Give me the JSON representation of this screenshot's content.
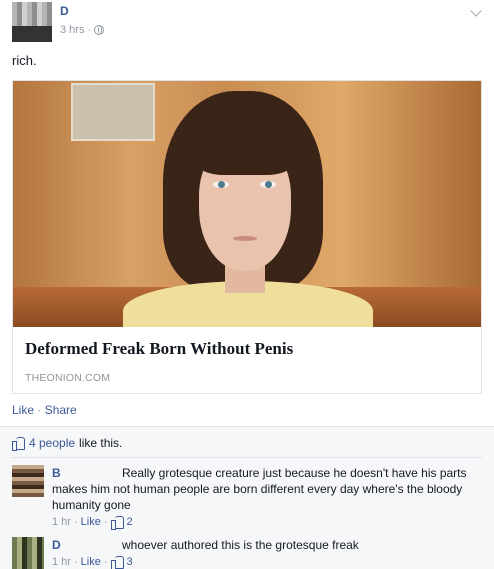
{
  "post": {
    "author": "D",
    "time": "3 hrs",
    "separator": "·",
    "text": "rich."
  },
  "link_card": {
    "title": "Deformed Freak Born Without Penis",
    "domain": "THEONION.COM"
  },
  "actions": {
    "like": "Like",
    "separator": "·",
    "share": "Share"
  },
  "likes": {
    "count": "4 people",
    "suffix": "like this."
  },
  "comments": [
    {
      "author": "B",
      "text": "Really grotesque creature just because he doesn't have his parts makes him not human people are born different every day where's the bloody humanity gone",
      "time": "1 hr",
      "like": "Like",
      "likes": "2"
    },
    {
      "author": "D",
      "text": "whoever authored this is the grotesque freak",
      "time": "1 hr",
      "like": "Like",
      "likes": "3"
    }
  ],
  "icons": {
    "audience": "globe-icon",
    "options": "chevron-down-icon",
    "like": "thumbs-up-icon"
  },
  "colors": {
    "link": "#3b5998",
    "meta": "#9197a3",
    "ufi_background": "#f6f7f9"
  }
}
